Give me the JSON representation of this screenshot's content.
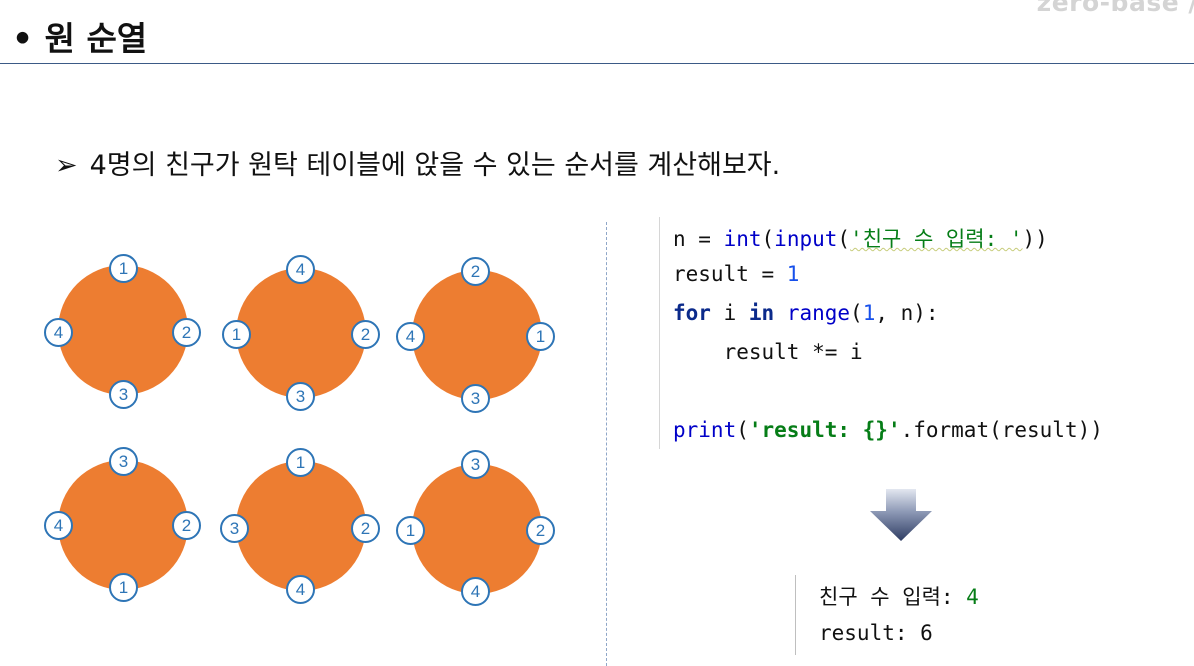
{
  "brand": {
    "logo_text": "zero-base /"
  },
  "title": {
    "bullet": "•",
    "text": "원 순열"
  },
  "subtitle": {
    "arrow": "➢",
    "text": "4명의 친구가 원탁 테이블에 앉을 수 있는 순서를 계산해보자."
  },
  "circles": [
    {
      "top": "1",
      "right": "2",
      "bottom": "3",
      "left": "4"
    },
    {
      "top": "4",
      "right": "2",
      "bottom": "3",
      "left": "1"
    },
    {
      "top": "2",
      "right": "1",
      "bottom": "3",
      "left": "4"
    },
    {
      "top": "3",
      "right": "2",
      "bottom": "1",
      "left": "4"
    },
    {
      "top": "1",
      "right": "2",
      "bottom": "4",
      "left": "3"
    },
    {
      "top": "3",
      "right": "2",
      "bottom": "4",
      "left": "1"
    }
  ],
  "code": {
    "line1": {
      "a": "n = ",
      "b": "int",
      "c": "(",
      "d": "input",
      "e": "(",
      "f": "'친구 수 입력: '",
      "g": "))"
    },
    "line2": {
      "a": "result = ",
      "b": "1"
    },
    "line3": {
      "a": "for",
      "b": " i ",
      "c": "in",
      "d": " ",
      "e": "range",
      "f": "(",
      "g": "1",
      "h": ", n):"
    },
    "line4": {
      "a": "    result *= i"
    },
    "line6": {
      "a": "print",
      "b": "(",
      "c": "'result: {}'",
      "d": ".format(result))"
    }
  },
  "output": {
    "line1_label": "친구 수 입력: ",
    "line1_value": "4",
    "line2": "result: 6"
  },
  "colors": {
    "table": "#ed7d31",
    "seat_border": "#2e75b6",
    "title_rule": "#3b5a86",
    "arrow_top": "#d9deea",
    "arrow_bottom": "#2f3d63"
  }
}
